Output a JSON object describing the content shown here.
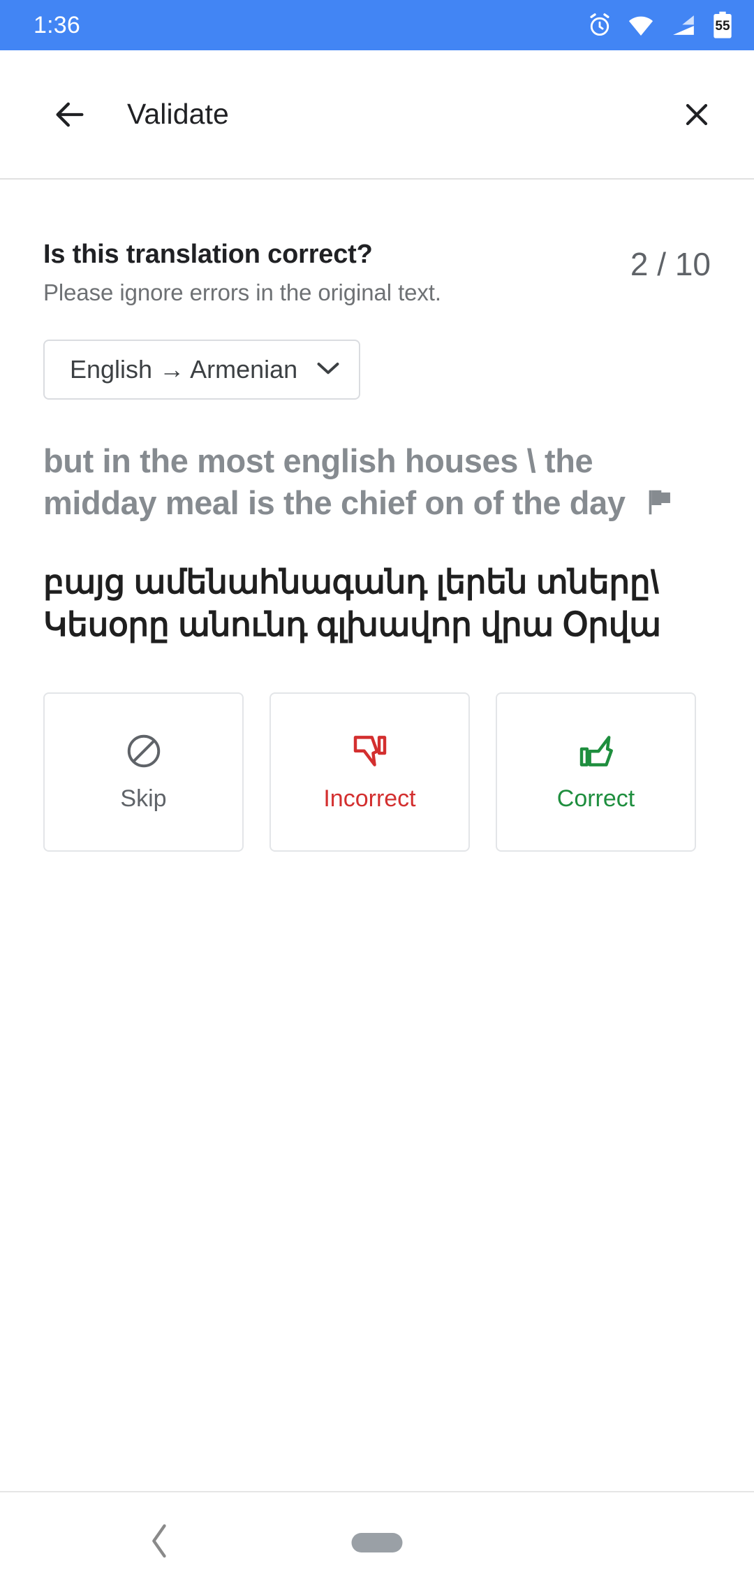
{
  "status_bar": {
    "clock": "1:36",
    "battery_percent": "55",
    "icons": [
      "alarm-icon",
      "wifi-icon",
      "signal-icon",
      "battery-icon"
    ],
    "background_color": "#4285f4"
  },
  "toolbar": {
    "back_icon": "arrow-back-icon",
    "title": "Validate",
    "close_icon": "close-icon"
  },
  "question": {
    "title": "Is this translation correct?",
    "subtitle": "Please ignore errors in the original text.",
    "counter": "2 / 10",
    "current_index": 2,
    "total": 10
  },
  "language_selector": {
    "label": "English → Armenian",
    "source_language": "English",
    "target_language": "Armenian",
    "chevron_icon": "chevron-down-icon"
  },
  "source_text": {
    "text": "but in the most english houses \\ the midday meal is the chief on of the day",
    "flag_icon": "flag-icon",
    "color": "#868b90"
  },
  "target_text": {
    "text": "բայց ամենահնագանդ լերեն տները\\ Կեսօրը անունդ գլխավոր վրա Օրվա",
    "color": "#1f1f1f"
  },
  "actions": [
    {
      "id": "skip",
      "label": "Skip",
      "icon": "block-icon",
      "color": "#5f6368"
    },
    {
      "id": "incorrect",
      "label": "Incorrect",
      "icon": "thumb-down-icon",
      "color": "#d32f2f"
    },
    {
      "id": "correct",
      "label": "Correct",
      "icon": "thumb-up-icon",
      "color": "#1e8e3e"
    }
  ],
  "nav_bar": {
    "back_icon": "nav-back-chevron-icon",
    "home_handle": "nav-home-pill"
  }
}
